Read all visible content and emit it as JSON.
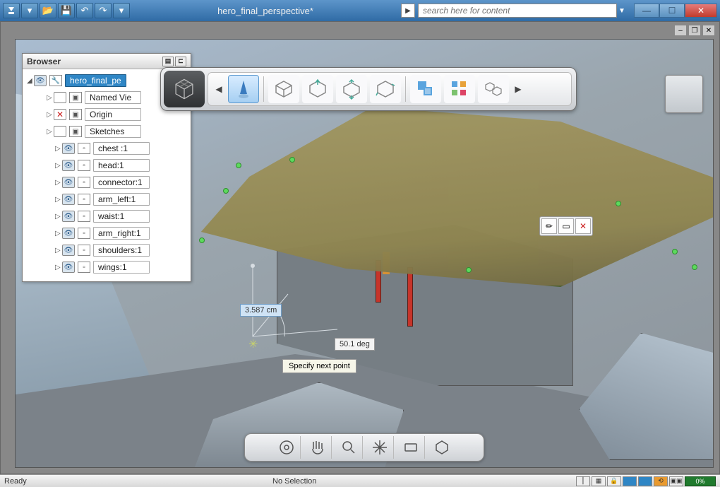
{
  "title": "hero_final_perspective*",
  "search": {
    "placeholder": "search here for content"
  },
  "browser": {
    "title": "Browser",
    "root": "hero_final_pe",
    "items": [
      {
        "label": "Named Vie",
        "eye": "blank",
        "indent": 1
      },
      {
        "label": "Origin",
        "eye": "cross",
        "indent": 1
      },
      {
        "label": "Sketches",
        "eye": "blank",
        "indent": 1
      },
      {
        "label": "chest :1",
        "eye": "on",
        "indent": 2
      },
      {
        "label": "head:1",
        "eye": "on",
        "indent": 2
      },
      {
        "label": "connector:1",
        "eye": "on",
        "indent": 2
      },
      {
        "label": "arm_left:1",
        "eye": "on",
        "indent": 2
      },
      {
        "label": "waist:1",
        "eye": "on",
        "indent": 2
      },
      {
        "label": "arm_right:1",
        "eye": "on",
        "indent": 2
      },
      {
        "label": "shoulders:1",
        "eye": "on",
        "indent": 2
      },
      {
        "label": "wings:1",
        "eye": "on",
        "indent": 2
      }
    ]
  },
  "dimension_length": "3.587 cm",
  "dimension_angle": "50.1 deg",
  "tooltip": "Specify next point",
  "status": {
    "left": "Ready",
    "mid": "No Selection",
    "progress": "0%"
  },
  "ribbon_tools": [
    "sculpt-tool",
    "box-primitive",
    "extrude",
    "revolve",
    "sweep",
    "pattern",
    "array",
    "merge"
  ],
  "nav_tools": [
    "orbit",
    "pan",
    "zoom",
    "move",
    "look",
    "fit"
  ]
}
